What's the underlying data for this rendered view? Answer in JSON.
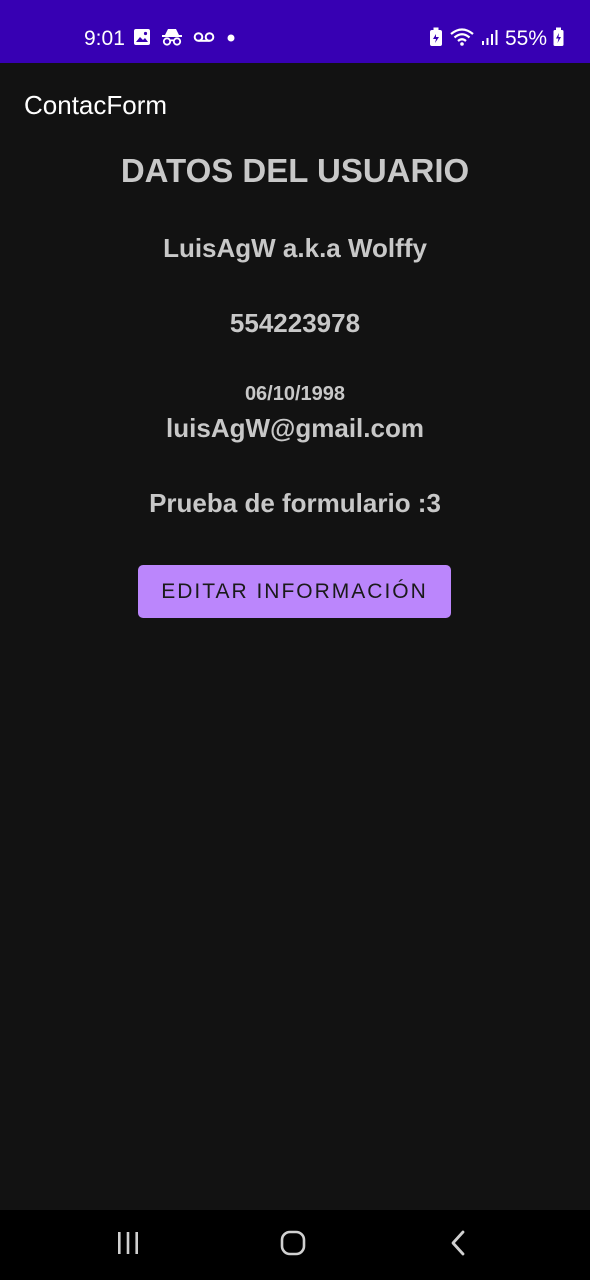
{
  "status_bar": {
    "time": "9:01",
    "battery": "55%",
    "background_color": "#3700b3",
    "icons_left": [
      "image-icon",
      "incognito-icon",
      "voicemail-icon",
      "dot-icon"
    ],
    "icons_right": [
      "battery-saver-icon",
      "wifi-icon",
      "signal-icon",
      "battery-icon"
    ]
  },
  "app_bar": {
    "title": "ContacForm"
  },
  "main": {
    "heading": "DATOS DEL USUARIO",
    "name": "LuisAgW a.k.a Wolffy",
    "phone": "554223978",
    "birth_date": "06/10/1998",
    "email": "luisAgW@gmail.com",
    "description": "Prueba de formulario :3",
    "edit_button_label": "EDITAR INFORMACIÓN",
    "accent_color": "#bb86fc"
  },
  "nav_bar": {
    "buttons": [
      "recent-apps-icon",
      "home-icon",
      "back-icon"
    ]
  }
}
